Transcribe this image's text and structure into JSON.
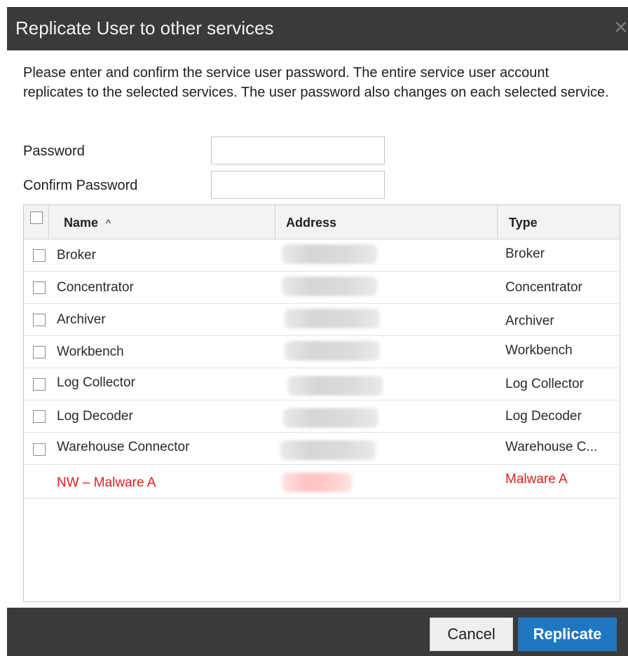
{
  "dialog": {
    "title": "Replicate User to other services",
    "close_glyph": "×",
    "intro": "Please enter and confirm the service user password. The entire service user account replicates to the selected services. The user password also changes on each selected service.",
    "password_label": "Password",
    "password_value": "",
    "confirm_label": "Confirm Password",
    "confirm_value": ""
  },
  "grid": {
    "columns": {
      "name": "Name",
      "sort_indicator": "^",
      "address": "Address",
      "type": "Type"
    },
    "rows": [
      {
        "name": "Broker",
        "type": "Broker"
      },
      {
        "name": "Concentrator",
        "type": "Concentrator"
      },
      {
        "name": "Archiver",
        "type": "Archiver"
      },
      {
        "name": "Workbench",
        "type": "Workbench"
      },
      {
        "name": "Log Collector",
        "type": "Log Collector"
      },
      {
        "name": "Log Decoder",
        "type": "Log Decoder"
      },
      {
        "name": "Warehouse Connector",
        "type": "Warehouse C..."
      },
      {
        "name": "NW – Malware A",
        "type": "Malware A",
        "warning": true
      }
    ],
    "warning_color": "#e0201a"
  },
  "footer": {
    "cancel_label": "Cancel",
    "replicate_label": "Replicate",
    "accent_color": "#1f77c2"
  }
}
